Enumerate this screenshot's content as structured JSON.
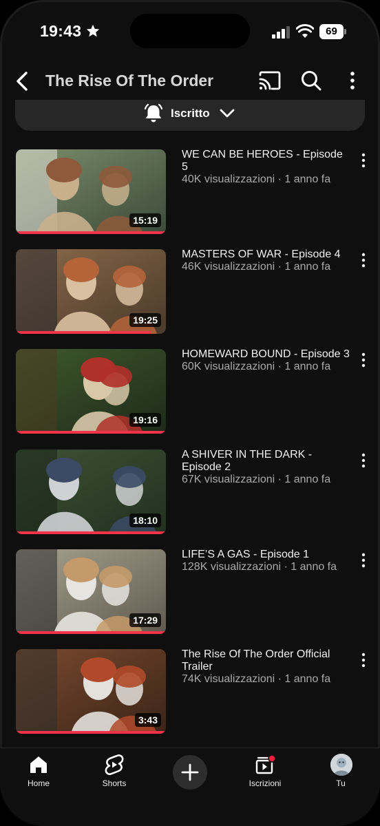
{
  "status_bar": {
    "time": "19:43",
    "battery": "69"
  },
  "header": {
    "title": "The Rise Of The Order"
  },
  "subscription": {
    "label": "Iscritto"
  },
  "videos": [
    {
      "title": "WE CAN BE HEROES - Episode 5",
      "meta": "40K visualizzazioni · 1 anno fa",
      "duration": "15:19",
      "progress": 1.0,
      "palette": [
        "#3d4a3a",
        "#7b8d6a",
        "#c9b08c",
        "#8e5a3b",
        "#e8e2da"
      ]
    },
    {
      "title": "MASTERS OF WAR - Episode 4",
      "meta": "46K visualizzazioni · 1 anno fa",
      "duration": "19:25",
      "progress": 0.9,
      "palette": [
        "#4a3a2a",
        "#8b6a4a",
        "#d8c0a0",
        "#b5643a",
        "#2a2a30"
      ]
    },
    {
      "title": "HOMEWARD BOUND - Episode 3",
      "meta": "60K visualizzazioni · 1 anno fa",
      "duration": "19:16",
      "progress": 1.0,
      "palette": [
        "#1e2a1a",
        "#3f5a2c",
        "#d8c8a8",
        "#b0302a",
        "#4a3a22"
      ]
    },
    {
      "title": "A SHIVER IN THE DARK - Episode 2",
      "meta": "67K visualizzazioni · 1 anno fa",
      "duration": "18:10",
      "progress": 1.0,
      "palette": [
        "#22301f",
        "#3e5236",
        "#cfd2d4",
        "#3c4a66",
        "#1a2218"
      ]
    },
    {
      "title": "LIFE’S A GAS - Episode 1",
      "meta": "128K visualizzazioni · 1 anno fa",
      "duration": "17:29",
      "progress": 1.0,
      "palette": [
        "#5e5a4e",
        "#a8a290",
        "#e6e4de",
        "#c49a6a",
        "#2a2a2a"
      ]
    },
    {
      "title": "The Rise Of The Order Official Trailer",
      "meta": "74K visualizzazioni · 1 anno fa",
      "duration": "3:43",
      "progress": 1.0,
      "palette": [
        "#3a2418",
        "#7a4a2e",
        "#e4e0dc",
        "#b04a2a",
        "#30302e"
      ]
    }
  ],
  "bottom_nav": {
    "home": "Home",
    "shorts": "Shorts",
    "subscriptions": "Iscrizioni",
    "you": "Tu"
  },
  "colors": {
    "background": "#0f0f0f",
    "progress": "#f2334a",
    "pill": "#272727",
    "meta_text": "#aaaaaa"
  }
}
